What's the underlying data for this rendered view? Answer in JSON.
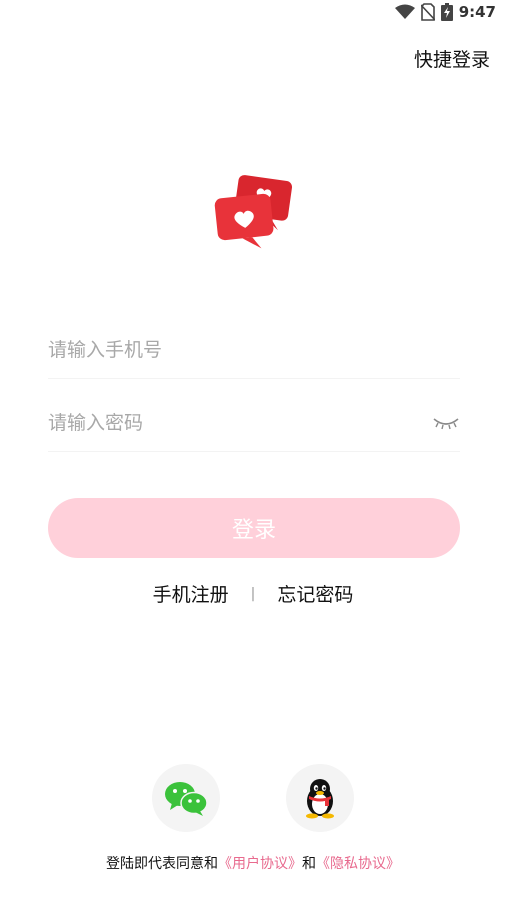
{
  "status_bar": {
    "time": "9:47",
    "icons": [
      "wifi-icon",
      "no-sim-icon",
      "battery-charging-icon"
    ]
  },
  "header": {
    "quick_login_label": "快捷登录"
  },
  "logo": {
    "icon": "heart-chat-bubbles-icon",
    "colors": {
      "bubble": "#e8333a",
      "heart": "#ffffff"
    }
  },
  "form": {
    "phone_placeholder": "请输入手机号",
    "password_placeholder": "请输入密码",
    "password_toggle_icon": "eye-closed-icon",
    "login_label": "登录"
  },
  "links": {
    "register_label": "手机注册",
    "divider": "|",
    "forgot_label": "忘记密码"
  },
  "social": {
    "wechat_icon": "wechat-icon",
    "qq_icon": "qq-icon"
  },
  "agreement": {
    "prefix": "登陆即代表同意和",
    "user_agreement": "《用户协议》",
    "and": "和",
    "privacy_agreement": "《隐私协议》"
  },
  "colors": {
    "accent": "#e86a8e",
    "button_bg": "#ffd0da",
    "placeholder": "#a8a8a8"
  }
}
